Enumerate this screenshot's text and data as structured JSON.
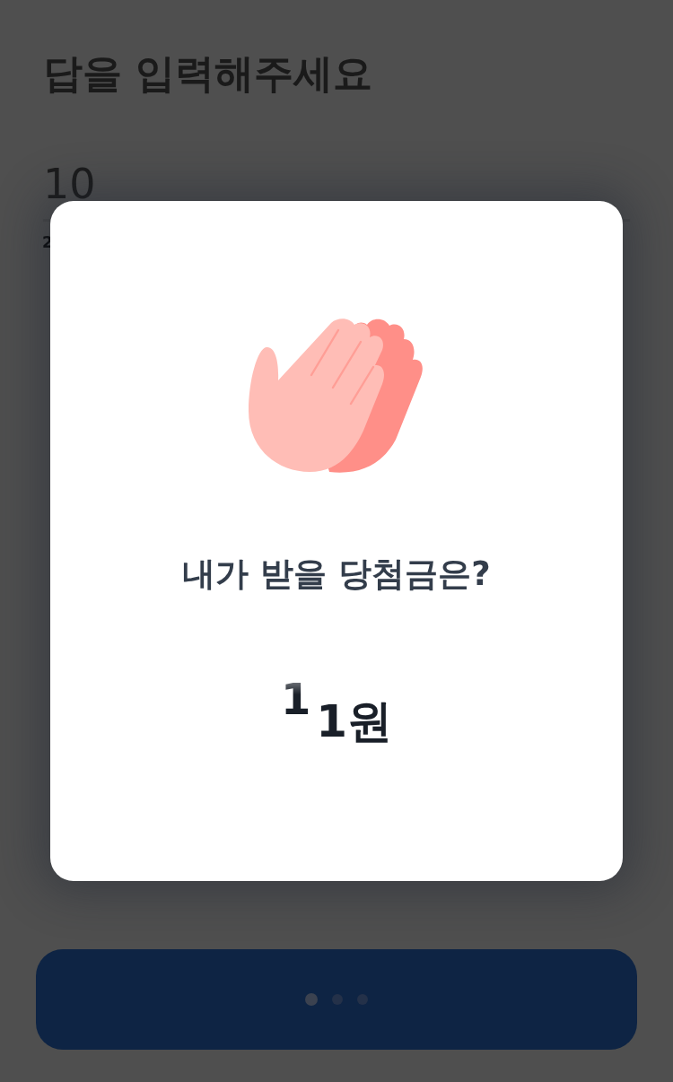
{
  "page": {
    "title": "답을 입력해주세요",
    "answer_field": {
      "value": "10"
    },
    "helper_text": "2"
  },
  "submit_button": {
    "loading": true
  },
  "modal": {
    "title": "내가 받을 당첨금은?",
    "prize": {
      "rolling_digit": "1",
      "amount": "1원"
    }
  }
}
